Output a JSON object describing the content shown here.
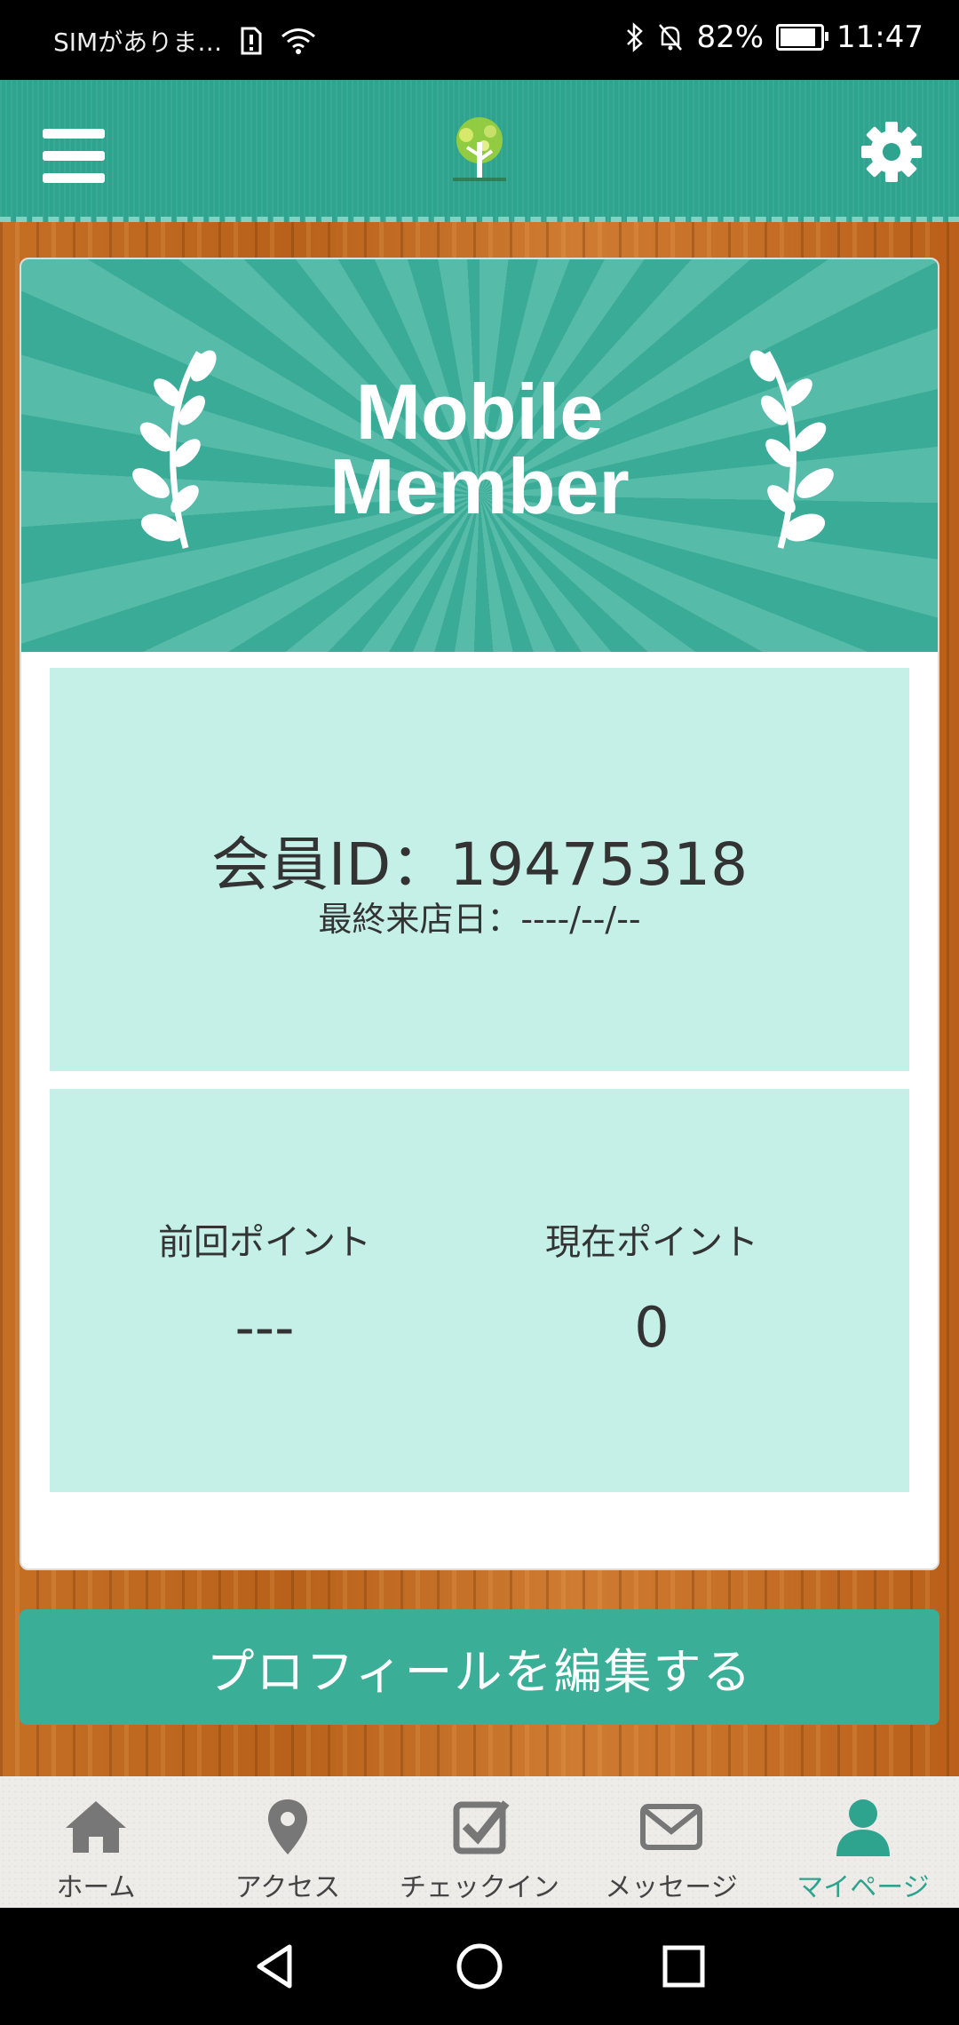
{
  "status_bar": {
    "carrier": "SIMがありま…",
    "battery": "82%",
    "time": "11:47"
  },
  "header": {
    "logo_icon": "tree-logo-icon",
    "menu_icon": "hamburger-menu-icon",
    "settings_icon": "gear-icon"
  },
  "banner": {
    "line1": "Mobile",
    "line2": "Member"
  },
  "member": {
    "id_text": "会員ID：19475318",
    "last_visit_text": "最終来店日：----/--/--"
  },
  "points": {
    "previous_label": "前回ポイント",
    "previous_value": "---",
    "current_label": "現在ポイント",
    "current_value": "0"
  },
  "edit_button": {
    "label": "プロフィールを編集する"
  },
  "tabs": [
    {
      "label": "ホーム",
      "icon": "home-icon"
    },
    {
      "label": "アクセス",
      "icon": "map-pin-icon"
    },
    {
      "label": "チェックイン",
      "icon": "checkbox-icon"
    },
    {
      "label": "メッセージ",
      "icon": "envelope-icon"
    },
    {
      "label": "マイページ",
      "icon": "user-icon",
      "active": true
    }
  ],
  "colors": {
    "accent": "#2ea38e",
    "panel": "#c4f0e8",
    "button": "#3aae96"
  }
}
